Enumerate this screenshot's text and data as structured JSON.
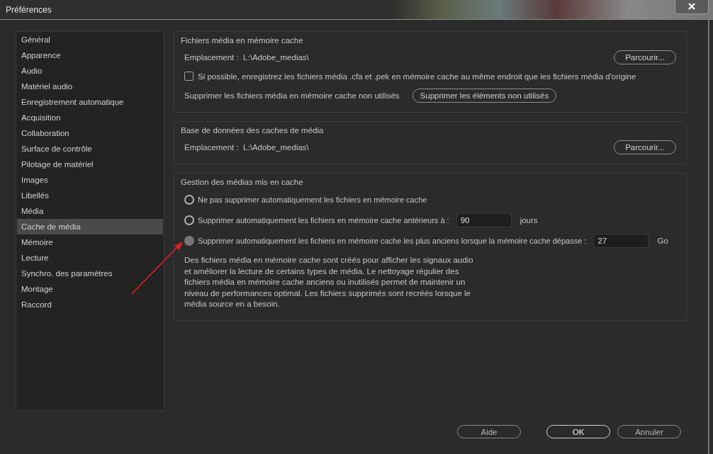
{
  "window": {
    "title": "Préférences"
  },
  "sidebar": {
    "items": [
      {
        "label": "Général",
        "selected": false
      },
      {
        "label": "Apparence",
        "selected": false
      },
      {
        "label": "Audio",
        "selected": false
      },
      {
        "label": "Matériel audio",
        "selected": false
      },
      {
        "label": "Enregistrement automatique",
        "selected": false
      },
      {
        "label": "Acquisition",
        "selected": false
      },
      {
        "label": "Collaboration",
        "selected": false
      },
      {
        "label": "Surface de contrôle",
        "selected": false
      },
      {
        "label": "Pilotage de matériel",
        "selected": false
      },
      {
        "label": "Images",
        "selected": false
      },
      {
        "label": "Libellés",
        "selected": false
      },
      {
        "label": "Média",
        "selected": false
      },
      {
        "label": "Cache de média",
        "selected": true
      },
      {
        "label": "Mémoire",
        "selected": false
      },
      {
        "label": "Lecture",
        "selected": false
      },
      {
        "label": "Synchro. des paramètres",
        "selected": false
      },
      {
        "label": "Montage",
        "selected": false
      },
      {
        "label": "Raccord",
        "selected": false
      }
    ]
  },
  "media_cache_files": {
    "title": "Fichiers média en mémoire cache",
    "location_label": "Emplacement :",
    "location": "L:\\Adobe_medias\\",
    "browse_button": "Parcourir...",
    "same_location": {
      "label": "Si possible, enregistrez les fichiers média .cfa et .pek en mémoire cache au même endroit que les fichiers média d'origine",
      "checked": false
    },
    "remove_label": "Supprimer les fichiers média en mémoire cache non utilisés",
    "remove_button": "Supprimer les éléments non utilisés"
  },
  "media_cache_database": {
    "title": "Base de données des caches de média",
    "location_label": "Emplacement :",
    "location": "L:\\Adobe_medias\\",
    "browse_button": "Parcourir..."
  },
  "cache_management": {
    "title": "Gestion des médias mis en cache",
    "options": [
      {
        "label": "Ne pas supprimer automatiquement les fichiers en mémoire cache",
        "selected": false,
        "disabled": false
      },
      {
        "label": "Supprimer automatiquement les fichiers en mémoire cache antérieurs à :",
        "selected": false,
        "disabled": false,
        "value": "90",
        "unit": "jours"
      },
      {
        "label": "Supprimer automatiquement les fichiers en mémoire cache les plus anciens lorsque la mémoire cache dépasse :",
        "selected": false,
        "disabled": true,
        "value": "27",
        "unit": "Go"
      }
    ],
    "description": "Des fichiers média en mémoire cache sont créés pour afficher les signaux audio et améliorer la lecture de certains types de média. Le nettoyage régulier des fichiers média en mémoire cache anciens ou inutilisés permet de maintenir un niveau de performances optimal. Les fichiers supprimés sont recréés lorsque le média source en a besoin."
  },
  "buttons": {
    "help": "Aide",
    "ok": "OK",
    "cancel": "Annuler"
  }
}
